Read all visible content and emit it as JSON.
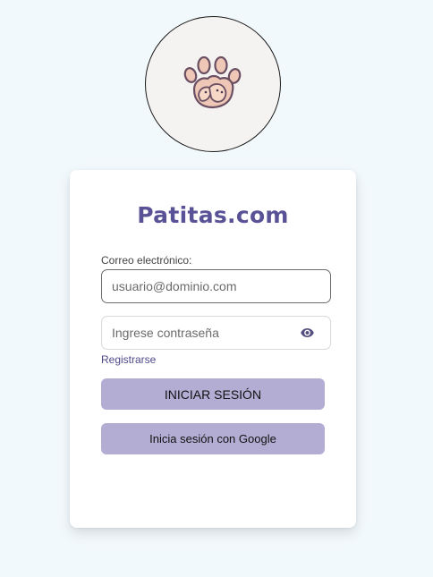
{
  "logo": {
    "icon": "paw-with-pets-icon"
  },
  "card": {
    "brand": "Patitas.com",
    "email_label": "Correo electrónico:",
    "email_placeholder": "usuario@dominio.com",
    "password_placeholder": "Ingrese contraseña",
    "password_toggle_icon": "eye-icon",
    "register_link": "Registrarse",
    "login_button": "INICIAR SESIÓN",
    "google_button": "Inicia sesión con Google"
  },
  "colors": {
    "page_background": "#f2f9fd",
    "brand": "#5a5296",
    "button": "#b3add4",
    "link": "#4e4a8a"
  }
}
